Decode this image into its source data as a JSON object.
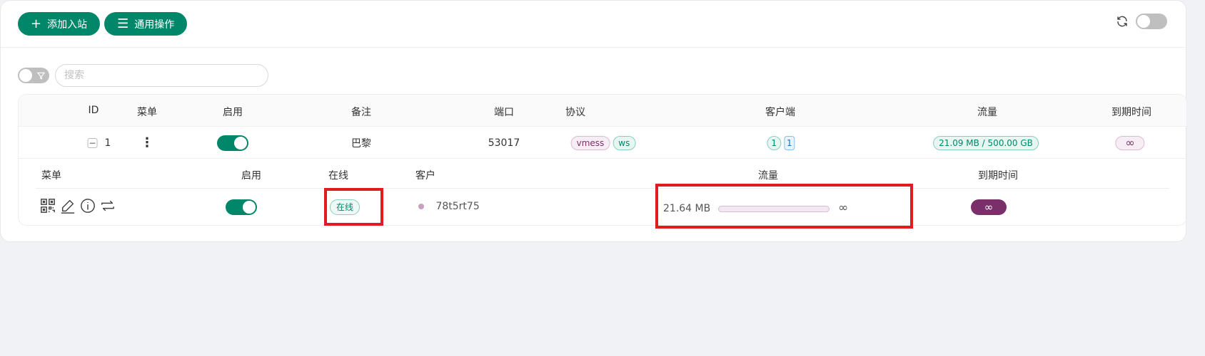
{
  "toolbar": {
    "add_inbound_label": "添加入站",
    "general_actions_label": "通用操作"
  },
  "search": {
    "placeholder": "搜索"
  },
  "table": {
    "headers": {
      "id": "ID",
      "menu": "菜单",
      "enable": "启用",
      "remark": "备注",
      "port": "端口",
      "protocol": "协议",
      "clients": "客户端",
      "traffic": "流量",
      "expiry": "到期时间"
    },
    "rows": [
      {
        "expand_symbol": "−",
        "id": "1",
        "menu_symbol": "⋮",
        "enabled": true,
        "remark": "巴黎",
        "port": "53017",
        "protocol": "vmess",
        "transport": "ws",
        "clients_total": "1",
        "clients_online": "1",
        "traffic": "21.09 MB / 500.00 GB",
        "expiry": "∞"
      }
    ]
  },
  "client_table": {
    "headers": {
      "menu": "菜单",
      "enable": "启用",
      "online": "在线",
      "client": "客户",
      "traffic": "流量",
      "expiry": "到期时间"
    },
    "rows": [
      {
        "menu_icons": [
          "qrcode-icon",
          "edit-icon",
          "info-icon",
          "reset-traffic-icon"
        ],
        "enabled": true,
        "online_status": "在线",
        "client_name": "78t5rt75",
        "traffic_used": "21.64 MB",
        "traffic_fraction": 0,
        "traffic_limit": "∞",
        "expiry": "∞"
      }
    ]
  },
  "colors": {
    "primary": "#00876a",
    "accent_purple": "#7a2f6a",
    "highlight_red": "#e21b23"
  }
}
